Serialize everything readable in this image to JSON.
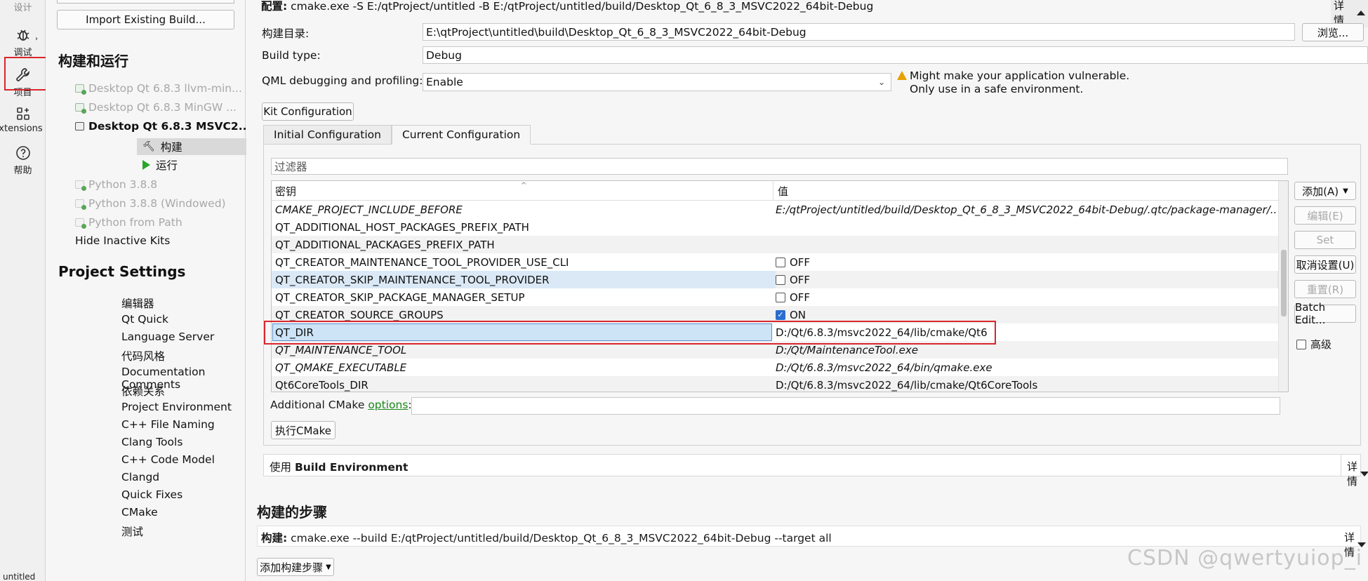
{
  "modebar": {
    "items": [
      {
        "label": "设计",
        "icon": "design-icon"
      },
      {
        "label": "调试",
        "icon": "bug-icon"
      },
      {
        "label": "项目",
        "icon": "wrench-icon"
      },
      {
        "label": "xtensions",
        "icon": "extensions-icon"
      },
      {
        "label": "帮助",
        "icon": "help-icon"
      }
    ],
    "bottom_label": "untitled"
  },
  "navigator": {
    "import_button": "Import Existing Build...",
    "build_run_heading": "构建和运行",
    "kits": [
      {
        "label": "Desktop Qt 6.8.3 llvm-min...",
        "active": false
      },
      {
        "label": "Desktop Qt 6.8.3 MinGW ...",
        "active": false
      },
      {
        "label": "Desktop Qt 6.8.3 MSVC2...",
        "active": true
      }
    ],
    "sub_items": {
      "build": "构建",
      "run": "运行"
    },
    "python_kits": [
      "Python 3.8.8",
      "Python 3.8.8 (Windowed)",
      "Python from Path"
    ],
    "hide_inactive": "Hide Inactive Kits",
    "project_settings_heading": "Project Settings",
    "project_settings": [
      "编辑器",
      "Qt Quick",
      "Language Server",
      "代码风格",
      "Documentation Comments",
      "依赖关系",
      "Project Environment",
      "C++ File Naming",
      "Clang Tools",
      "C++ Code Model",
      "Clangd",
      "Quick Fixes",
      "CMake",
      "测试"
    ]
  },
  "config": {
    "line_label": "配置:",
    "line_value": "cmake.exe -S E:/qtProject/untitled -B E:/qtProject/untitled/build/Desktop_Qt_6_8_3_MSVC2022_64bit-Debug",
    "details_label": "详情"
  },
  "build_dir": {
    "label": "构建目录:",
    "value": "E:\\qtProject\\untitled\\build\\Desktop_Qt_6_8_3_MSVC2022_64bit-Debug",
    "browse": "浏览..."
  },
  "build_type": {
    "label": "Build type:",
    "value": "Debug"
  },
  "qml_debug": {
    "label": "QML debugging and profiling:",
    "value": "Enable",
    "warning_line1": "Might make your application vulnerable.",
    "warning_line2": "Only use in a safe environment."
  },
  "kit_config_button": "Kit Configuration",
  "tabs": {
    "initial": "Initial Configuration",
    "current": "Current Configuration"
  },
  "filter_placeholder": "过滤器",
  "table": {
    "headers": {
      "key": "密钥",
      "value": "值"
    },
    "rows": [
      {
        "key": "CMAKE_PROJECT_INCLUDE_BEFORE",
        "value": "E:/qtProject/untitled/build/Desktop_Qt_6_8_3_MSVC2022_64bit-Debug/.qtc/package-manager/...",
        "italic": true,
        "checkbox": false
      },
      {
        "key": "QT_ADDITIONAL_HOST_PACKAGES_PREFIX_PATH",
        "value": "",
        "italic": false,
        "checkbox": false
      },
      {
        "key": "QT_ADDITIONAL_PACKAGES_PREFIX_PATH",
        "value": "",
        "italic": false,
        "checkbox": false
      },
      {
        "key": "QT_CREATOR_MAINTENANCE_TOOL_PROVIDER_USE_CLI",
        "value": "OFF",
        "italic": false,
        "checkbox": true,
        "checked": false
      },
      {
        "key": "QT_CREATOR_SKIP_MAINTENANCE_TOOL_PROVIDER",
        "value": "OFF",
        "italic": false,
        "checkbox": true,
        "checked": false
      },
      {
        "key": "QT_CREATOR_SKIP_PACKAGE_MANAGER_SETUP",
        "value": "OFF",
        "italic": false,
        "checkbox": true,
        "checked": false
      },
      {
        "key": "QT_CREATOR_SOURCE_GROUPS",
        "value": "ON",
        "italic": false,
        "checkbox": true,
        "checked": true
      },
      {
        "key": "QT_DIR",
        "value": "D:/Qt/6.8.3/msvc2022_64/lib/cmake/Qt6",
        "italic": false,
        "checkbox": false,
        "selected": true
      },
      {
        "key": "QT_MAINTENANCE_TOOL",
        "value": "D:/Qt/MaintenanceTool.exe",
        "italic": true,
        "checkbox": false
      },
      {
        "key": "QT_QMAKE_EXECUTABLE",
        "value": "D:/Qt/6.8.3/msvc2022_64/bin/qmake.exe",
        "italic": true,
        "checkbox": false
      },
      {
        "key": "Qt6CoreTools_DIR",
        "value": "D:/Qt/6.8.3/msvc2022_64/lib/cmake/Qt6CoreTools",
        "italic": false,
        "checkbox": false
      }
    ]
  },
  "side_buttons": {
    "add": "添加(A)",
    "edit": "编辑(E)",
    "set": "Set",
    "unset": "取消设置(U)",
    "reset": "重置(R)",
    "batch": "Batch Edit...",
    "advanced": "高级"
  },
  "additional_cmake": {
    "label_prefix": "Additional CMake ",
    "link": "options",
    "label_suffix": ":",
    "value": ""
  },
  "run_cmake_button": "执行CMake",
  "env": {
    "prefix": "使用 ",
    "bold": "Build Environment",
    "details": "详情"
  },
  "build_steps": {
    "heading": "构建的步骤",
    "label": "构建:",
    "value": "cmake.exe --build E:/qtProject/untitled/build/Desktop_Qt_6_8_3_MSVC2022_64bit-Debug --target all",
    "details": "详情",
    "add_step": "添加构建步骤"
  },
  "watermark": "CSDN @qwertyuiop_i",
  "colors": {
    "highlight_box": "#d9262c",
    "selection": "#cde4f7",
    "link": "#1b8a1b",
    "warning": "#e6a100"
  }
}
